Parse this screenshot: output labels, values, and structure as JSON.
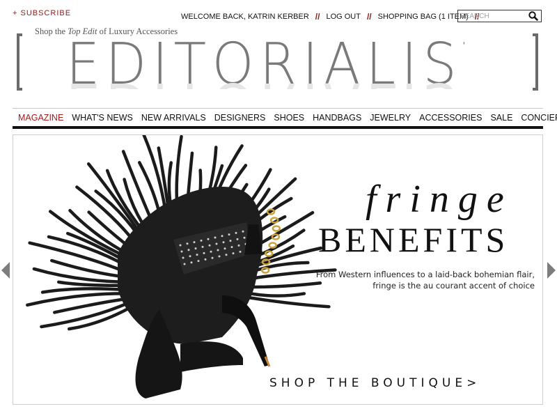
{
  "header": {
    "subscribe": "+ SUBSCRIBE",
    "welcome": "WELCOME BACK, KATRIN KERBER",
    "logout": "LOG OUT",
    "bag": "SHOPPING BAG (1 ITEM)",
    "separator": "//",
    "search_placeholder": "SEARCH"
  },
  "masthead": {
    "tagline_before": "Shop the ",
    "tagline_emphasis": "Top Edit",
    "tagline_after": " of Luxury Accessories",
    "logo": "EDITORIALIST"
  },
  "nav": {
    "items": [
      "MAGAZINE",
      "WHAT'S NEWS",
      "NEW ARRIVALS",
      "DESIGNERS",
      "SHOES",
      "HANDBAGS",
      "JEWELRY",
      "ACCESSORIES",
      "SALE",
      "CONCIERGE"
    ],
    "active_index": 0
  },
  "hero": {
    "headline_script": "fringe",
    "headline_caps": "BENEFITS",
    "subtext_line1": "From Western influences to a laid-back bohemian flair,",
    "subtext_line2": "fringe is the au courant accent of choice",
    "cta": "SHOP THE BOUTIQUE>"
  },
  "icons": {
    "search": "magnifier-icon",
    "prev": "chevron-left-icon",
    "next": "chevron-right-icon"
  },
  "colors": {
    "accent_red": "#a31b1b",
    "logo_gray": "#7a7a7a",
    "arrow_gray": "#7d7d7d"
  }
}
